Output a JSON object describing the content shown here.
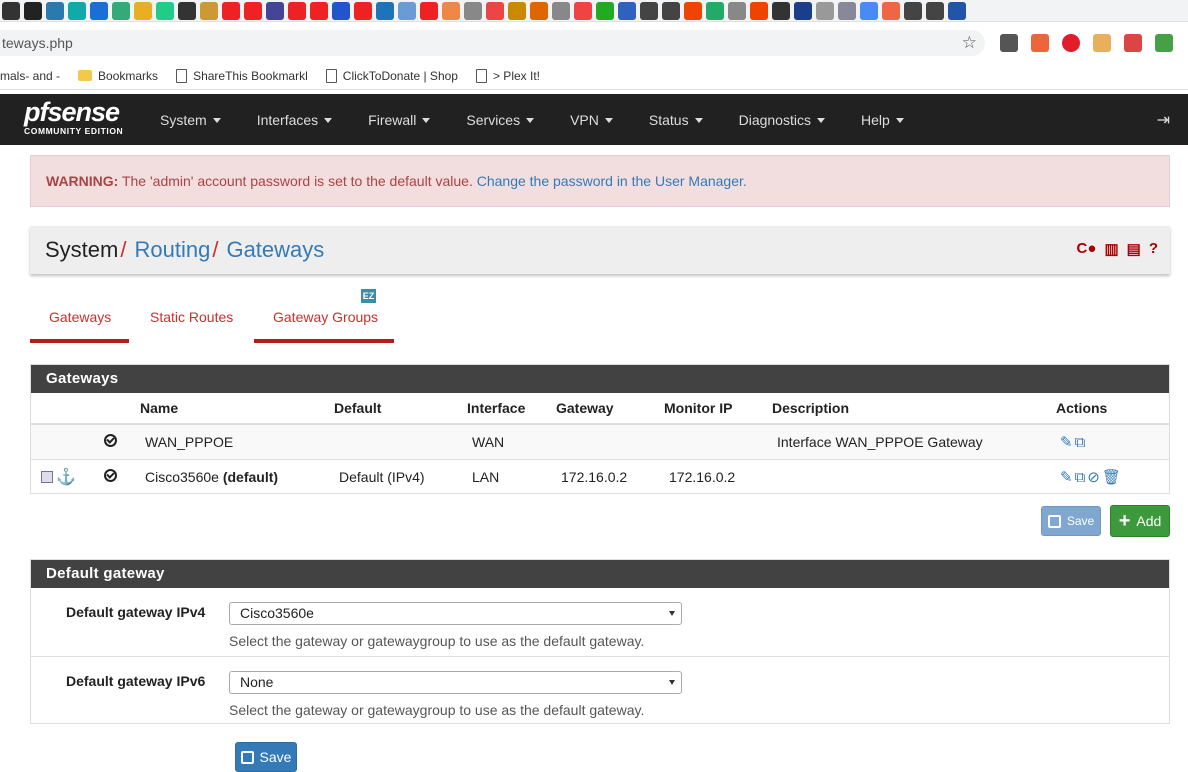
{
  "browser": {
    "address": "teways.php",
    "bookmarks": [
      {
        "label": "mals- and -",
        "icon": "none"
      },
      {
        "label": "Bookmarks",
        "icon": "folder"
      },
      {
        "label": "ShareThis Bookmarkl",
        "icon": "doc"
      },
      {
        "label": "ClickToDonate | Shop",
        "icon": "doc"
      },
      {
        "label": "> Plex It!",
        "icon": "doc"
      }
    ]
  },
  "logo": {
    "brand": "sense",
    "prefix": "pf",
    "edition": "COMMUNITY EDITION"
  },
  "nav": {
    "items": [
      "System",
      "Interfaces",
      "Firewall",
      "Services",
      "VPN",
      "Status",
      "Diagnostics",
      "Help"
    ]
  },
  "warning": {
    "label": "WARNING:",
    "text": " The 'admin' account password is set to the default value. ",
    "link": "Change the password in the User Manager."
  },
  "breadcrumb": {
    "part1": "System",
    "sep1": "/",
    "part2": "Routing",
    "sep2": "/",
    "part3": "Gateways"
  },
  "tabs": {
    "gateways": "Gateways",
    "static_routes": "Static Routes",
    "gateway_groups": "Gateway Groups",
    "ez_badge": "EZ"
  },
  "gateways_panel": {
    "title": "Gateways",
    "columns": [
      "Name",
      "Default",
      "Interface",
      "Gateway",
      "Monitor IP",
      "Description",
      "Actions"
    ],
    "rows": [
      {
        "name": "WAN_PPPOE",
        "name_suffix": "",
        "default": "",
        "interface": "WAN",
        "gateway": "",
        "monitor_ip": "",
        "description": "Interface WAN_PPPOE Gateway"
      },
      {
        "name": "Cisco3560e",
        "name_suffix": "(default)",
        "default": "Default (IPv4)",
        "interface": "LAN",
        "gateway": "172.16.0.2",
        "monitor_ip": "172.16.0.2",
        "description": ""
      }
    ]
  },
  "buttons": {
    "save_disabled": "Save",
    "add": "Add",
    "save": "Save"
  },
  "default_gateway_panel": {
    "title": "Default gateway",
    "ipv4": {
      "label": "Default gateway IPv4",
      "value": "Cisco3560e",
      "help": "Select the gateway or gatewaygroup to use as the default gateway."
    },
    "ipv6": {
      "label": "Default gateway IPv6",
      "value": "None",
      "help": "Select the gateway or gatewaygroup to use as the default gateway."
    }
  },
  "colors": {
    "navbar": "#212121",
    "accent_red": "#c9302c",
    "link_blue": "#337ab7",
    "panel_head": "#424242",
    "add_green": "#3c9a3c"
  }
}
